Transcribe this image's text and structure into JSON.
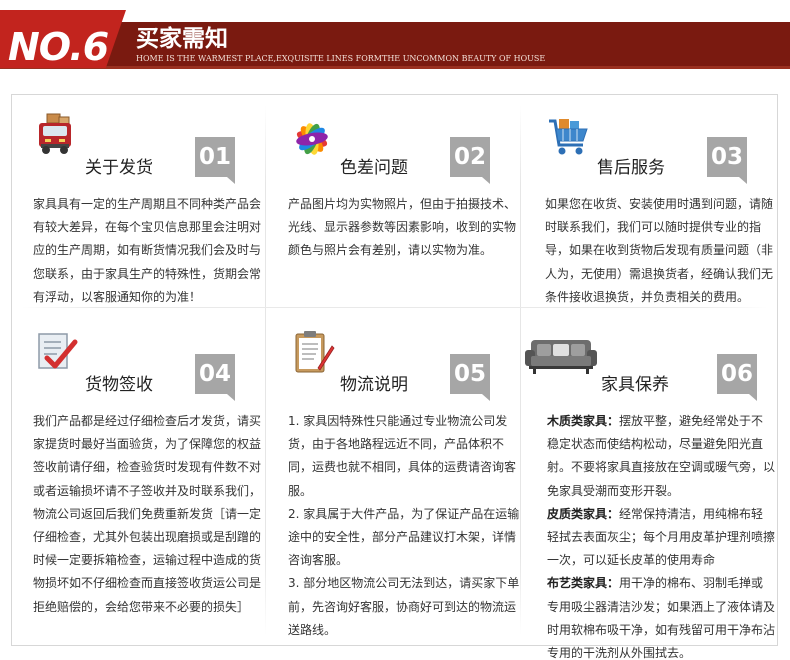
{
  "header": {
    "badge": "NO.6",
    "title": "买家需知",
    "subtitle": "HOME IS THE WARMEST PLACE,EXQUISITE LINES FORMTHE UNCOMMON BEAUTY OF HOUSE"
  },
  "cells": [
    {
      "num": "01",
      "title": "关于发货",
      "icon": "delivery-truck-icon",
      "lines": [
        "家具具有一定的生产周期且不同种类产品会有较大差异，在每个宝贝信息那里会注明对应的生产周期，如有断货情况我们会及时与您联系，由于家具生产的特殊性，货期会常有浮动，以客服通知你的为准！"
      ]
    },
    {
      "num": "02",
      "title": "色差问题",
      "icon": "color-palette-icon",
      "lines": [
        "产品图片均为实物照片，但由于拍摄技术、光线、显示器参数等因素影响，收到的实物颜色与照片会有差别，请以实物为准。"
      ]
    },
    {
      "num": "03",
      "title": "售后服务",
      "icon": "shopping-cart-icon",
      "lines": [
        "如果您在收货、安装使用时遇到问题，请随时联系我们，我们可以随时提供专业的指导，如果在收到货物后发现有质量问题（非人为，无使用）需退换货者，经确认我们无条件接收退换货，并负责相关的费用。"
      ]
    },
    {
      "num": "04",
      "title": "货物签收",
      "icon": "checklist-sign-icon",
      "lines": [
        "我们产品都是经过仔细检查后才发货，请买家提货时最好当面验货，为了保障您的权益签收前请仔细，检查验货时发现有件数不对或者运输损坏请不子签收并及时联系我们，物流公司返回后我们免费重新发货［请一定仔细检查，尤其外包装出现磨损或是刮蹭的时候一定要拆箱检查，运输过程中造成的货物损坏如不仔细检查而直接签收货运公司是拒绝赔偿的，会给您带来不必要的损失］"
      ]
    },
    {
      "num": "05",
      "title": "物流说明",
      "icon": "clipboard-pen-icon",
      "lines": [
        "1. 家具因特殊性只能通过专业物流公司发货，由于各地路程远近不同，产品体积不同，运费也就不相同，具体的运费请咨询客服。",
        "2. 家具属于大件产品，为了保证产品在运输途中的安全性，部分产品建议打木架，详情咨询客服。",
        "3. 部分地区物流公司无法到达，请买家下单前，先咨询好客服，协商好可到达的物流运送路线。"
      ]
    },
    {
      "num": "06",
      "title": "家具保养",
      "icon": "sofa-icon",
      "care": [
        {
          "label": "木质类家具：",
          "text": "摆放平整，避免经常处于不稳定状态而使结构松动，尽量避免阳光直射。不要将家具直接放在空调或暖气旁，以免家具受潮而变形开裂。"
        },
        {
          "label": "皮质类家具：",
          "text": "经常保持清洁，用纯棉布轻轻拭去表面灰尘；每个月用皮革护理剂喷擦一次，可以延长皮革的使用寿命"
        },
        {
          "label": "布艺类家具：",
          "text": "用干净的棉布、羽制毛掸或专用吸尘器清洁沙发；如果洒上了液体请及时用软棉布吸干净，如有残留可用干净布沾专用的干洗剂从外围拭去。"
        }
      ]
    }
  ]
}
